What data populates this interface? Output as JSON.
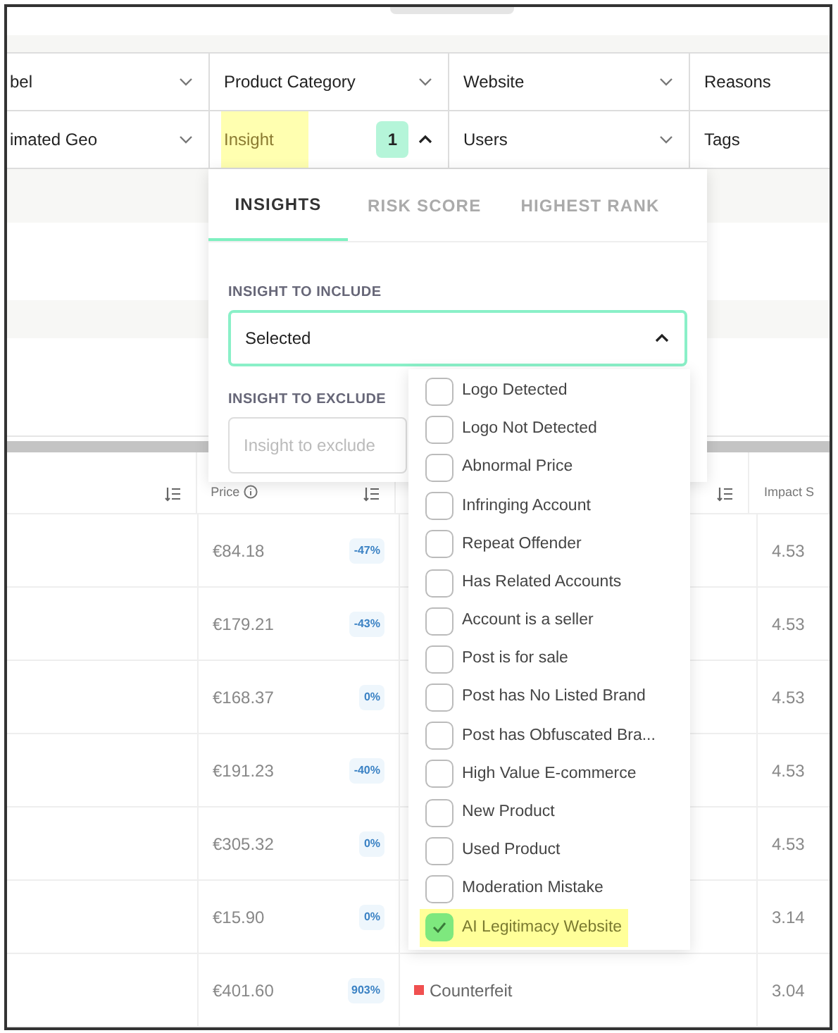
{
  "filter_rows": [
    [
      {
        "label": "bel",
        "kind": "dropdown",
        "expanded": false,
        "highlighted": false
      },
      {
        "label": "Product Category",
        "kind": "dropdown",
        "expanded": false,
        "highlighted": false
      },
      {
        "label": "Website",
        "kind": "dropdown",
        "expanded": false,
        "highlighted": false
      },
      {
        "label": "Reasons",
        "kind": "plain",
        "highlighted": false
      }
    ],
    [
      {
        "label": "imated Geo",
        "kind": "dropdown",
        "expanded": false,
        "highlighted": false
      },
      {
        "label": "Insight",
        "kind": "dropdown",
        "expanded": true,
        "highlighted": true,
        "count": "1"
      },
      {
        "label": "Users",
        "kind": "dropdown",
        "expanded": false,
        "highlighted": false
      },
      {
        "label": "Tags",
        "kind": "plain",
        "highlighted": false
      }
    ]
  ],
  "popover": {
    "tabs": [
      {
        "label": "INSIGHTS",
        "selected": true
      },
      {
        "label": "RISK SCORE",
        "selected": false
      },
      {
        "label": "HIGHEST RANK",
        "selected": false
      }
    ],
    "include_label": "INSIGHT TO INCLUDE",
    "include_value": "Selected",
    "include_expanded": true,
    "exclude_label": "INSIGHT TO EXCLUDE",
    "exclude_placeholder": "Insight to exclude",
    "options": [
      {
        "label": "Logo Detected",
        "checked": false
      },
      {
        "label": "Logo Not Detected",
        "checked": false
      },
      {
        "label": "Abnormal Price",
        "checked": false
      },
      {
        "label": "Infringing Account",
        "checked": false
      },
      {
        "label": "Repeat Offender",
        "checked": false
      },
      {
        "label": "Has Related Accounts",
        "checked": false
      },
      {
        "label": "Account is a seller",
        "checked": false
      },
      {
        "label": "Post is for sale",
        "checked": false
      },
      {
        "label": "Post has No Listed Brand",
        "checked": false
      },
      {
        "label": "Post has Obfuscated Bra...",
        "checked": false
      },
      {
        "label": "High Value E-commerce",
        "checked": false
      },
      {
        "label": "New Product",
        "checked": false
      },
      {
        "label": "Used Product",
        "checked": false
      },
      {
        "label": "Moderation Mistake",
        "checked": false
      },
      {
        "label": "AI Legitimacy Website",
        "checked": true
      }
    ]
  },
  "table": {
    "columns": [
      {
        "sortable": true
      },
      {
        "label": "Price",
        "info": true,
        "sortable": true
      },
      {
        "sortable": true
      },
      {
        "label": "Impact S",
        "sortable": false
      }
    ],
    "rows": [
      {
        "price": "€84.18",
        "change": "-47%",
        "impact": "4.53"
      },
      {
        "price": "€179.21",
        "change": "-43%",
        "impact": "4.53"
      },
      {
        "price": "€168.37",
        "change": "0%",
        "impact": "4.53"
      },
      {
        "price": "€191.23",
        "change": "-40%",
        "impact": "4.53"
      },
      {
        "price": "€305.32",
        "change": "0%",
        "impact": "4.53"
      },
      {
        "price": "€15.90",
        "change": "0%",
        "impact": "3.14"
      },
      {
        "price": "€401.60",
        "change": "903%",
        "category": "Counterfeit",
        "impact": "3.04"
      }
    ]
  }
}
